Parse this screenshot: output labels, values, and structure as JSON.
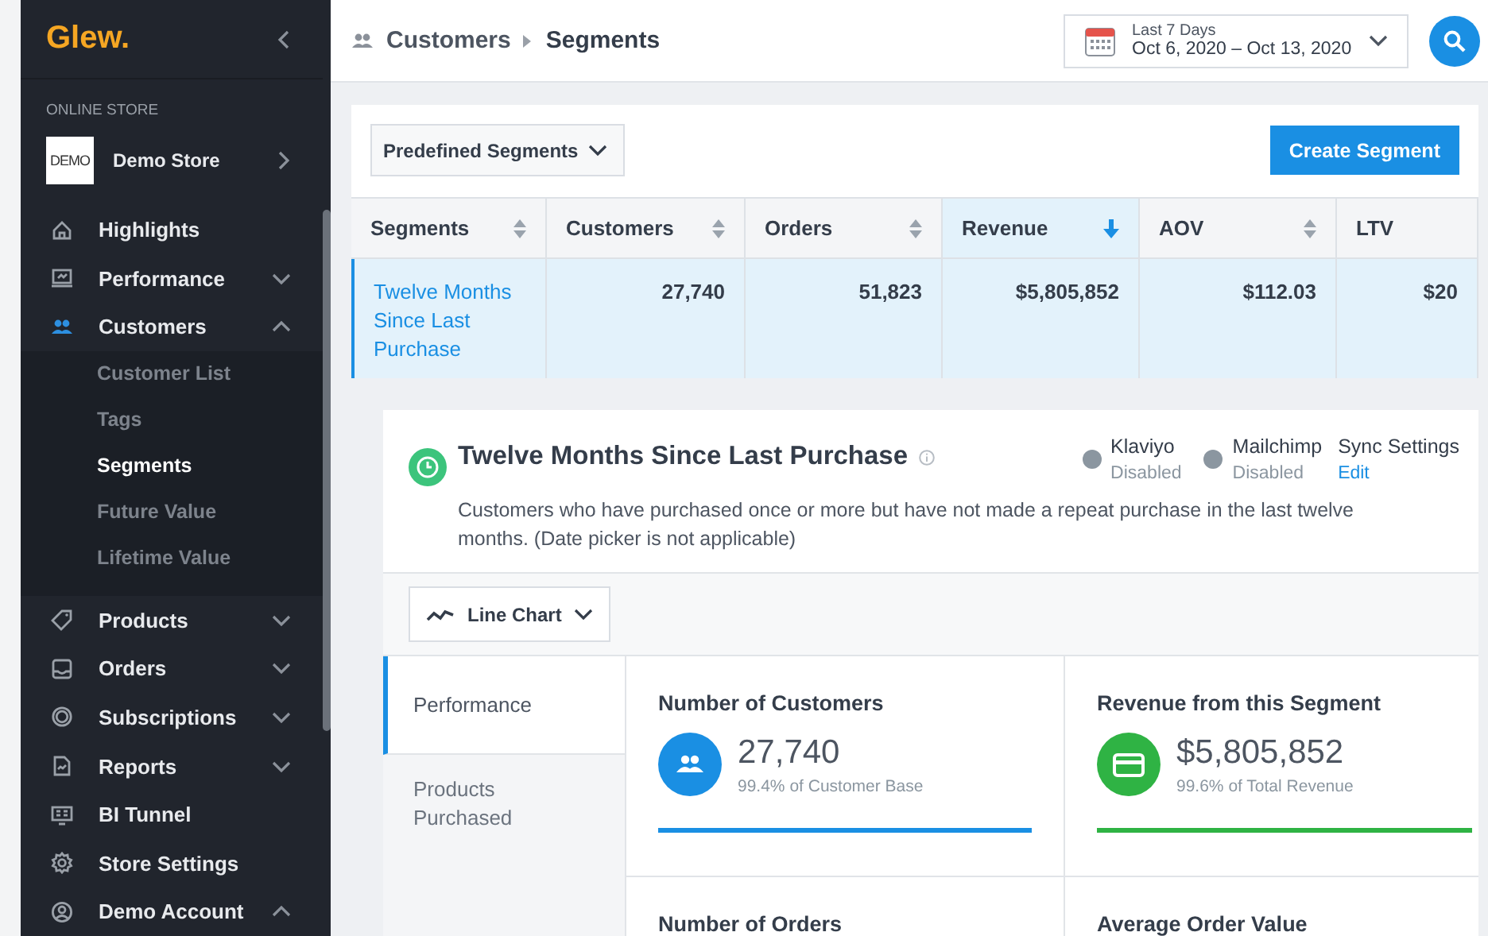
{
  "sidebar": {
    "logo": "Glew.",
    "section_label": "ONLINE STORE",
    "store": {
      "logo_text": "DEMO",
      "name": "Demo Store"
    },
    "nav": [
      {
        "label": "Highlights",
        "kind": "link",
        "selected": false
      },
      {
        "label": "Performance",
        "kind": "group",
        "expanded": false,
        "selected": false
      },
      {
        "label": "Customers",
        "kind": "group",
        "expanded": true,
        "selected": true,
        "children": [
          {
            "label": "Customer List",
            "selected": false
          },
          {
            "label": "Tags",
            "selected": false
          },
          {
            "label": "Segments",
            "selected": true
          },
          {
            "label": "Future Value",
            "selected": false
          },
          {
            "label": "Lifetime Value",
            "selected": false
          }
        ]
      },
      {
        "label": "Products",
        "kind": "group",
        "expanded": false,
        "selected": false
      },
      {
        "label": "Orders",
        "kind": "group",
        "expanded": false,
        "selected": false
      },
      {
        "label": "Subscriptions",
        "kind": "group",
        "expanded": false,
        "selected": false
      },
      {
        "label": "Reports",
        "kind": "group",
        "expanded": false,
        "selected": false
      },
      {
        "label": "BI Tunnel",
        "kind": "link",
        "selected": false
      },
      {
        "label": "Store Settings",
        "kind": "link",
        "selected": false
      },
      {
        "label": "Demo Account",
        "kind": "group",
        "expanded": true,
        "selected": false
      }
    ]
  },
  "header": {
    "breadcrumb": [
      "Customers",
      "Segments"
    ],
    "date_range": {
      "label": "Last 7 Days",
      "range": "Oct 6, 2020 – Oct 13, 2020"
    }
  },
  "segments": {
    "filter": "Predefined Segments",
    "create_button": "Create Segment",
    "table": {
      "columns": [
        {
          "label": "Segments",
          "sorted": false
        },
        {
          "label": "Customers",
          "sorted": false
        },
        {
          "label": "Orders",
          "sorted": false
        },
        {
          "label": "Revenue",
          "sorted": true
        },
        {
          "label": "AOV",
          "sorted": false
        },
        {
          "label": "LTV"
        }
      ],
      "rows": [
        {
          "selected": true,
          "cells": [
            "Twelve Months Since Last Purchase",
            "27,740",
            "51,823",
            "$5,805,852",
            "$112.03",
            "$20"
          ]
        }
      ]
    }
  },
  "detail": {
    "title": "Twelve Months Since Last Purchase",
    "description": "Customers who have purchased once or more but have not made a repeat purchase in the last twelve months. (Date picker is not applicable)",
    "integrations": [
      {
        "name": "Klaviyo",
        "status": "Disabled"
      },
      {
        "name": "Mailchimp",
        "status": "Disabled"
      }
    ],
    "sync": {
      "label": "Sync Settings",
      "action": "Edit"
    },
    "chart_type": "Line Chart",
    "tabs": [
      {
        "label": "Performance",
        "selected": true
      },
      {
        "label": "Products Purchased",
        "selected": false
      }
    ],
    "metrics": [
      {
        "title": "Number of Customers",
        "value": "27,740",
        "note": "99.4% of Customer Base",
        "color": "#1a8fe3"
      },
      {
        "title": "Revenue from this Segment",
        "value": "$5,805,852",
        "note": "99.6% of Total Revenue",
        "color": "#2fb344"
      },
      {
        "title": "Number of Orders"
      },
      {
        "title": "Average Order Value"
      }
    ]
  }
}
